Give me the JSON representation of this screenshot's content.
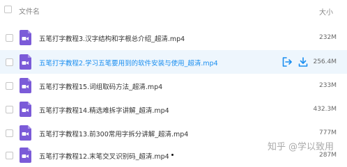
{
  "header": {
    "name_label": "文件名",
    "size_label": "大小"
  },
  "files": [
    {
      "name": "五笔打字教程3.汉字结构和字根总介绍_超清.mp4",
      "size": "232M",
      "icon": "video-file-icon"
    },
    {
      "name": "五笔打字教程2.学习五笔要用到的软件安装与使用_超清.mp4",
      "size": "256.4M",
      "icon": "video-file-icon",
      "highlighted": true
    },
    {
      "name": "五笔打字教程15.词组取码方法_超清.mp4",
      "size": "233M",
      "icon": "video-file-icon"
    },
    {
      "name": "五笔打字教程14.精选难拆字讲解_超清.mp4",
      "size": "432.3M",
      "icon": "video-file-icon"
    },
    {
      "name": "五笔打字教程13.前300常用字拆分讲解_超清.mp4",
      "size": "777M",
      "icon": "video-file-icon"
    },
    {
      "name": "五笔打字教程12.末笔交叉识别码_超清.mp4",
      "size": "287M",
      "icon": "video-file-icon"
    }
  ],
  "row_actions": {
    "share_icon": "share-icon",
    "download_icon": "download-icon"
  },
  "watermark": {
    "site": "知乎",
    "author": "@学以致用"
  },
  "colors": {
    "accent": "#1a8ef0",
    "icon_purple": "#7b5bd8",
    "highlight_bg": "#eef6fd"
  }
}
